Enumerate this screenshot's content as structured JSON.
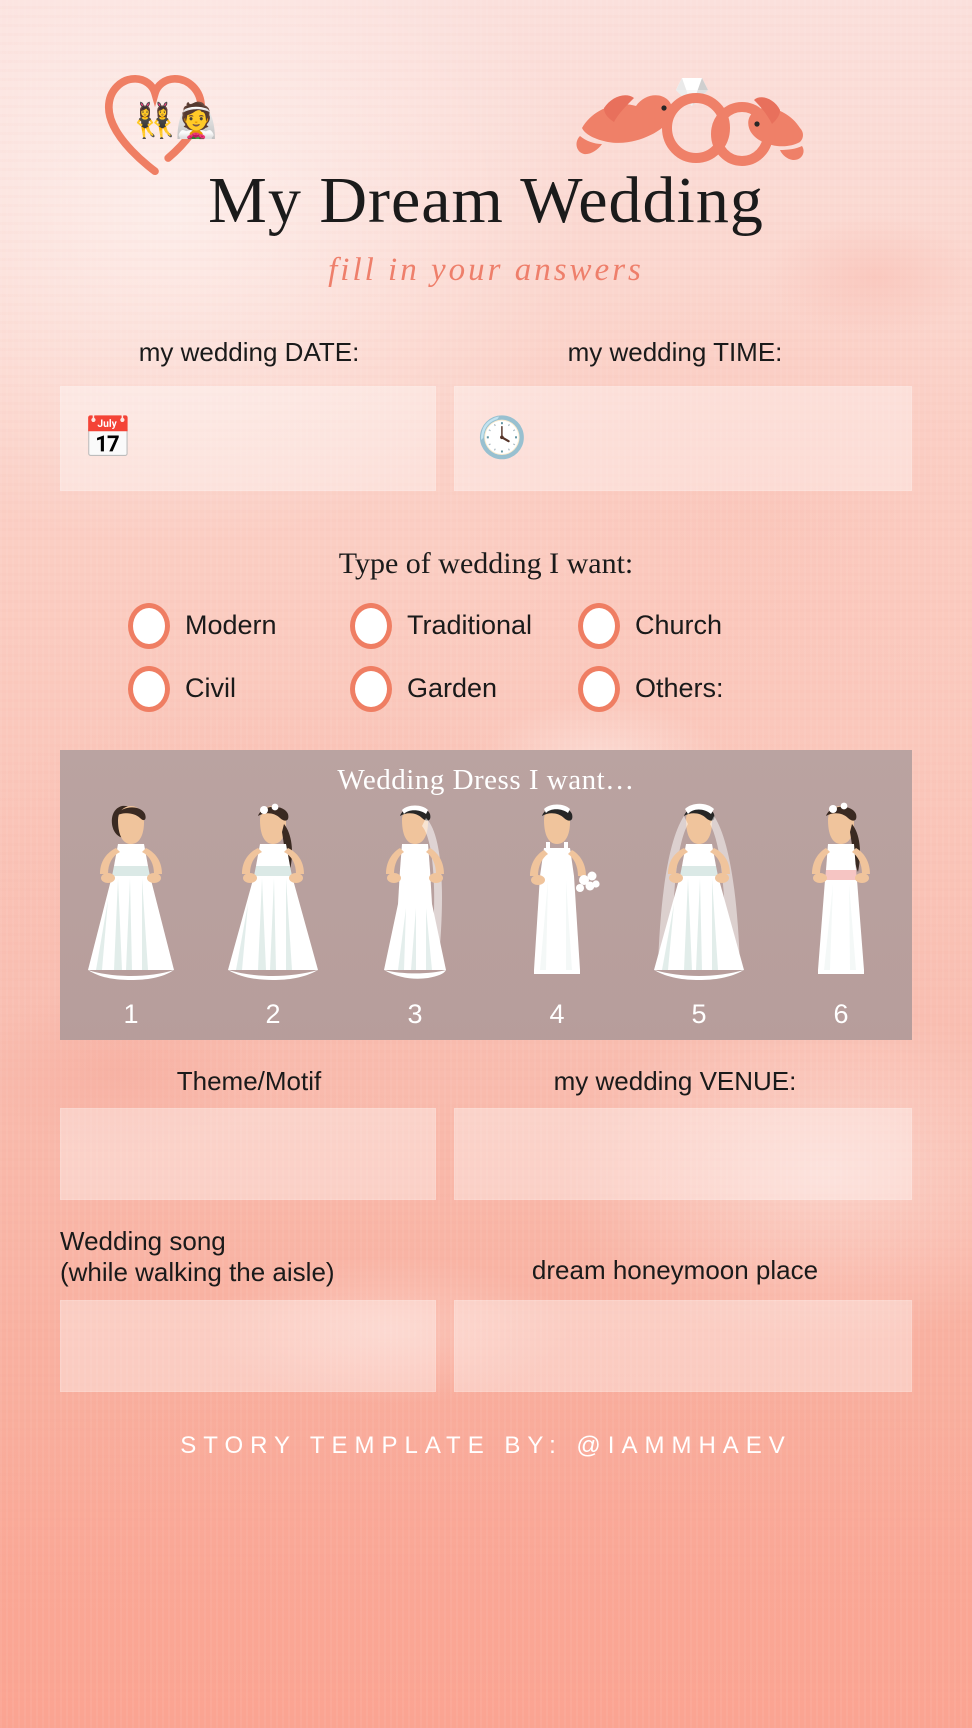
{
  "header": {
    "title": "My Dream Wedding",
    "subtitle": "fill in your answers",
    "heart_icon": "heart-outline-icon",
    "couple_icon": "bride-and-groom-icon",
    "rings_icon": "doves-with-wedding-rings-icon"
  },
  "date_time": {
    "date_label": "my wedding DATE:",
    "time_label": "my wedding TIME:",
    "date_value": "",
    "time_value": "",
    "date_placeholder": "",
    "time_placeholder": "",
    "calendar_icon": "📅",
    "clock_icon": "🕓"
  },
  "wedding_type": {
    "heading": "Type of wedding I want:",
    "options": [
      {
        "label": "Modern",
        "selected": false
      },
      {
        "label": "Traditional",
        "selected": false
      },
      {
        "label": "Church",
        "selected": false
      },
      {
        "label": "Civil",
        "selected": false
      },
      {
        "label": "Garden",
        "selected": false
      },
      {
        "label": "Others:",
        "selected": false
      }
    ]
  },
  "dress": {
    "title": "Wedding Dress I want…",
    "numbers": [
      "1",
      "2",
      "3",
      "4",
      "5",
      "6"
    ]
  },
  "fields": {
    "theme_label": "Theme/Motif",
    "theme_value": "",
    "venue_label": "my wedding VENUE:",
    "venue_value": "",
    "song_label": "Wedding song\n(while walking the aisle)",
    "song_value": "",
    "honeymoon_label": "dream honeymoon place",
    "honeymoon_value": ""
  },
  "footer": {
    "credit": "STORY TEMPLATE BY: @IAMMHAEV"
  },
  "colors": {
    "accent": "#ef7e63",
    "subtitle": "#ee7f6b",
    "text": "#1a1a1a",
    "field_fill": "#ffffff",
    "panel_overlay": "#a89292",
    "background_top": "#fbe0dc",
    "background_bottom": "#fba492"
  }
}
